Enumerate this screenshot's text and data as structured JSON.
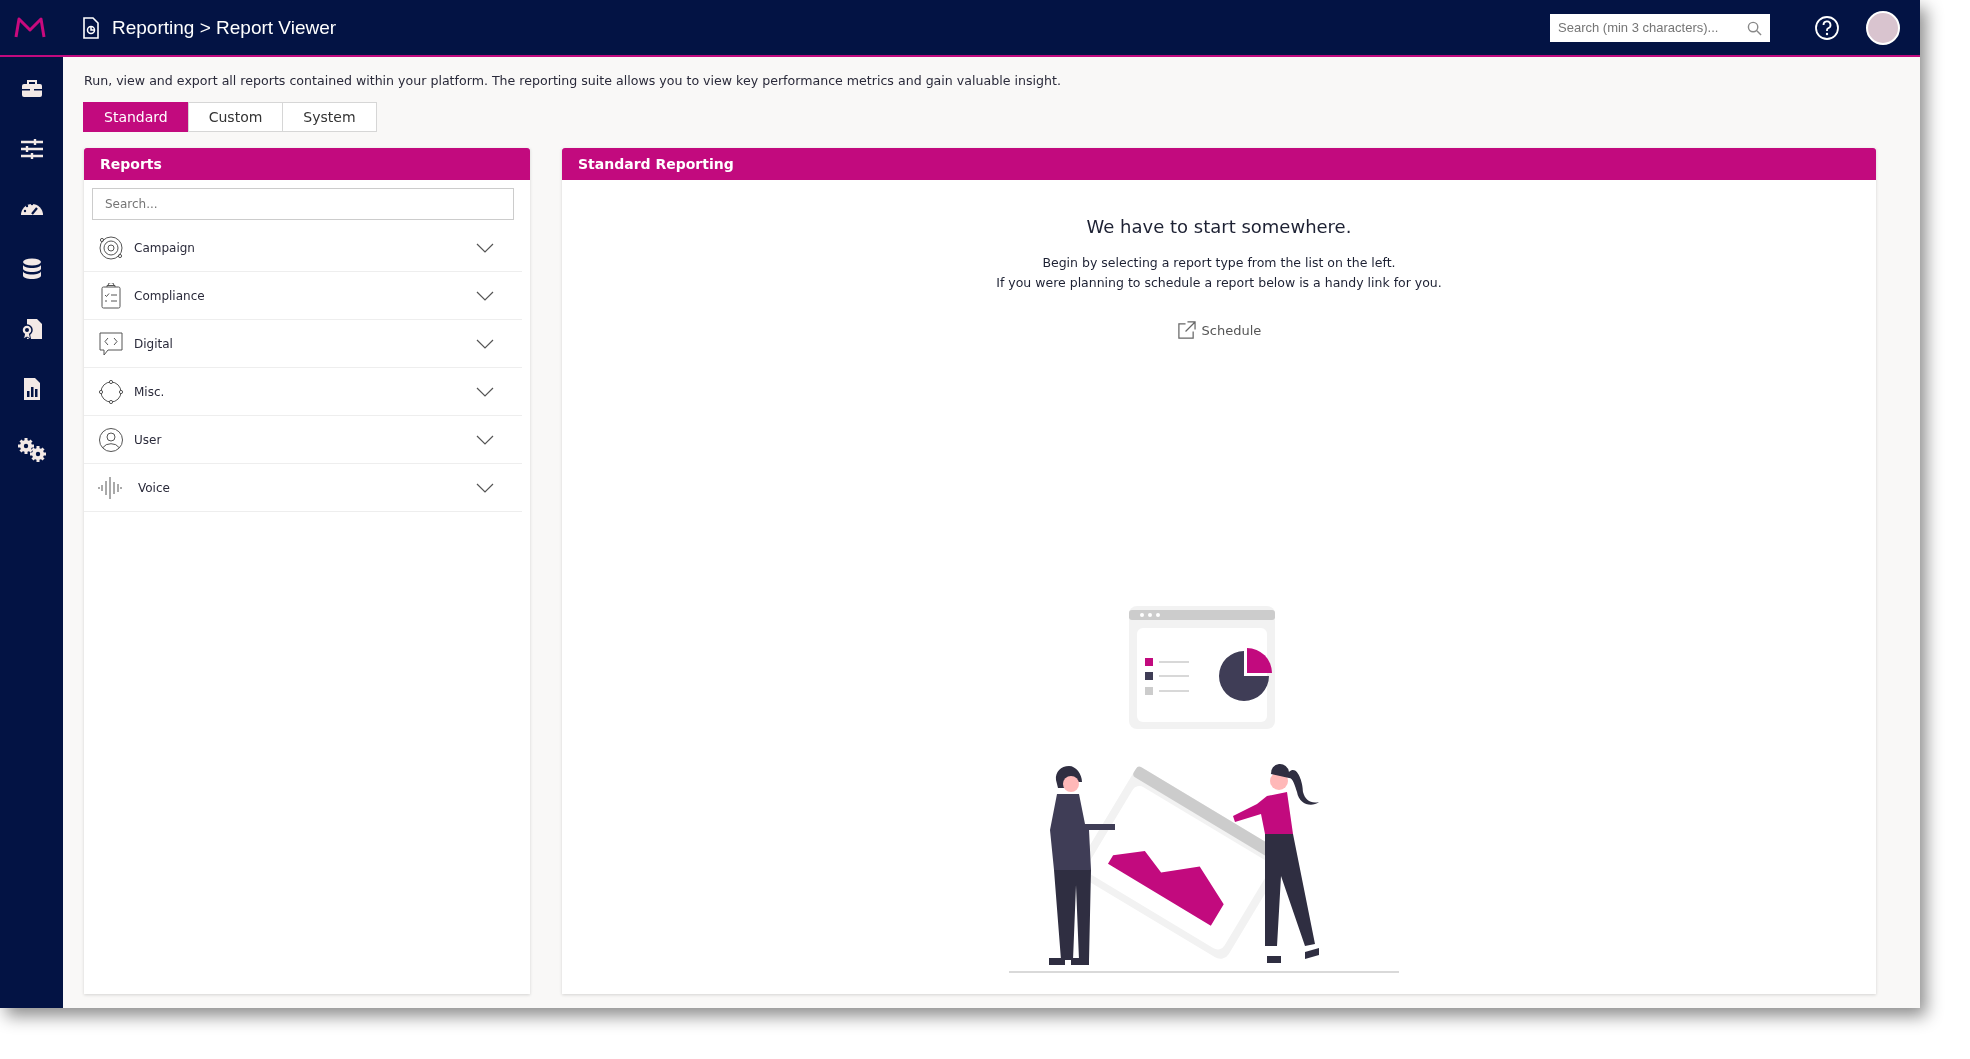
{
  "header": {
    "breadcrumb": "Reporting > Report Viewer",
    "search": {
      "placeholder": "Search (min 3 characters)..."
    }
  },
  "description": "Run, view and export all reports contained within your platform. The reporting suite allows you to view key performance metrics and gain valuable insight.",
  "tabs": [
    {
      "label": "Standard",
      "selected": true
    },
    {
      "label": "Custom",
      "selected": false
    },
    {
      "label": "System",
      "selected": false
    }
  ],
  "reports_panel": {
    "title": "Reports",
    "search": {
      "placeholder": "Search..."
    },
    "categories": [
      {
        "label": "Campaign",
        "kind": "campaign",
        "expanded": false
      },
      {
        "label": "Compliance",
        "kind": "compliance",
        "expanded": false
      },
      {
        "label": "Digital",
        "kind": "digital",
        "expanded": false
      },
      {
        "label": "Misc.",
        "kind": "misc",
        "expanded": false
      },
      {
        "label": "User",
        "kind": "user",
        "expanded": false
      },
      {
        "label": "Voice",
        "kind": "voice",
        "expanded": false
      }
    ]
  },
  "main_panel": {
    "title": "Standard Reporting",
    "heading": "We have to start somewhere.",
    "lines": [
      "Begin by selecting a report type from the list on the left.",
      "If you were planning to schedule a report below is a handy link for you."
    ],
    "link": "Schedule"
  }
}
